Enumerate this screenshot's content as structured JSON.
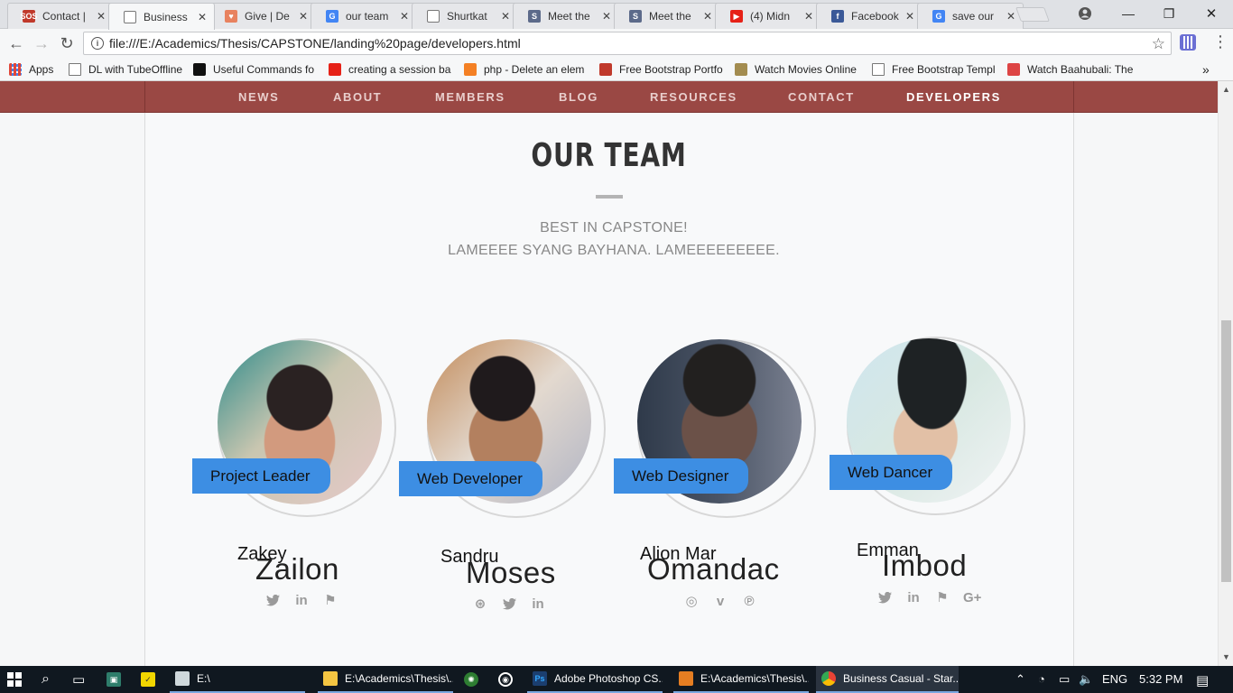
{
  "browser": {
    "tabs": [
      {
        "label": "Contact |",
        "icon": "sos-favicon-icon",
        "icon_color": "#c0392b",
        "icon_text": "SOS",
        "active": false
      },
      {
        "label": "Business",
        "icon": "page-icon",
        "icon_color": "#ffffff",
        "icon_text": "",
        "active": true
      },
      {
        "label": "Give | De",
        "icon": "give-favicon-icon",
        "icon_color": "#e8825f",
        "icon_text": "♥",
        "active": false
      },
      {
        "label": "our team",
        "icon": "google-icon",
        "icon_color": "#4285f4",
        "icon_text": "G",
        "active": false
      },
      {
        "label": "Shurtkat",
        "icon": "page-icon",
        "icon_color": "#ffffff",
        "icon_text": "",
        "active": false
      },
      {
        "label": "Meet the",
        "icon": "s-logo-icon",
        "icon_color": "#5c6a8a",
        "icon_text": "S",
        "active": false
      },
      {
        "label": "Meet the",
        "icon": "s-logo-icon",
        "icon_color": "#5c6a8a",
        "icon_text": "S",
        "active": false
      },
      {
        "label": "(4) Midn",
        "icon": "youtube-icon",
        "icon_color": "#e62117",
        "icon_text": "▶",
        "active": false
      },
      {
        "label": "Facebook",
        "icon": "facebook-icon",
        "icon_color": "#3b5998",
        "icon_text": "f",
        "active": false
      },
      {
        "label": "save our",
        "icon": "google-icon",
        "icon_color": "#4285f4",
        "icon_text": "G",
        "active": false
      }
    ],
    "close_glyph": "✕",
    "url": "file:///E:/Academics/Thesis/CAPSTONE/landing%20page/developers.html",
    "bookmarks": [
      {
        "label": "Apps",
        "icon": "apps-grid-icon",
        "color": "#e0473a"
      },
      {
        "label": "DL with TubeOffline",
        "icon": "file-icon",
        "color": "#ffffff"
      },
      {
        "label": "Useful Commands fo",
        "icon": "terminal-icon",
        "color": "#111111"
      },
      {
        "label": "creating a session ba",
        "icon": "youtube-icon",
        "color": "#e62117"
      },
      {
        "label": "php - Delete an elem",
        "icon": "stackoverflow-icon",
        "color": "#f48024"
      },
      {
        "label": "Free Bootstrap Portfo",
        "icon": "s-favicon-icon",
        "color": "#c0392b"
      },
      {
        "label": "Watch Movies Online",
        "icon": "film-reel-icon",
        "color": "#a38c50"
      },
      {
        "label": "Free Bootstrap Templ",
        "icon": "file-icon",
        "color": "#ffffff"
      },
      {
        "label": "Watch Baahubali: The",
        "icon": "one-favicon-icon",
        "color": "#d44"
      }
    ]
  },
  "site": {
    "nav": [
      "NEWS",
      "ABOUT",
      "MEMBERS",
      "BLOG",
      "RESOURCES",
      "CONTACT",
      "DEVELOPERS"
    ],
    "active_nav": "DEVELOPERS",
    "nav_color": "#9a4844",
    "section_title": "OUR TEAM",
    "subtitle_1": "BEST IN CAPSTONE!",
    "subtitle_2": "LAMEEEE SYANG BAYHANA. LAMEEEEEEEEE.",
    "accent": "#3d8ee3",
    "members": [
      {
        "role": "Project Leader",
        "first": "Zakey",
        "last": "Zailon",
        "socials": [
          "twitter-icon",
          "linkedin-icon",
          "foursquare-icon"
        ],
        "social_glyphs": [
          "🐦",
          "in",
          "⚑"
        ]
      },
      {
        "role": "Web Developer",
        "first": "Sandru",
        "last": "Moses",
        "socials": [
          "dribbble-icon",
          "twitter-icon",
          "linkedin-icon"
        ],
        "social_glyphs": [
          "⊛",
          "🐦",
          "in"
        ]
      },
      {
        "role": "Web Designer",
        "first": "Alion Mar",
        "last": "Omandac",
        "socials": [
          "instagram-icon",
          "vimeo-icon",
          "pinterest-icon"
        ],
        "social_glyphs": [
          "◎",
          "v",
          "℗"
        ]
      },
      {
        "role": "Web Dancer",
        "first": "Emman",
        "last": "Imbod",
        "socials": [
          "twitter-icon",
          "linkedin-icon",
          "foursquare-icon",
          "google-plus-icon"
        ],
        "social_glyphs": [
          "🐦",
          "in",
          "⚑",
          "G+"
        ]
      }
    ]
  },
  "taskbar": {
    "items": [
      {
        "label": "E:\\",
        "icon": "drive-icon",
        "color": "#cfd8dc"
      },
      {
        "label": "E:\\Academics\\Thesis\\...",
        "icon": "folder-icon",
        "color": "#f4c542"
      },
      {
        "label": "Adobe Photoshop CS...",
        "icon": "photoshop-icon",
        "color": "#1b3e6f"
      },
      {
        "label": "E:\\Academics\\Thesis\\...",
        "icon": "sublime-icon",
        "color": "#e67e22"
      },
      {
        "label": "Business Casual - Star...",
        "icon": "chrome-icon",
        "color": "#4caf50"
      }
    ],
    "language": "ENG",
    "time": "5:32 PM"
  }
}
